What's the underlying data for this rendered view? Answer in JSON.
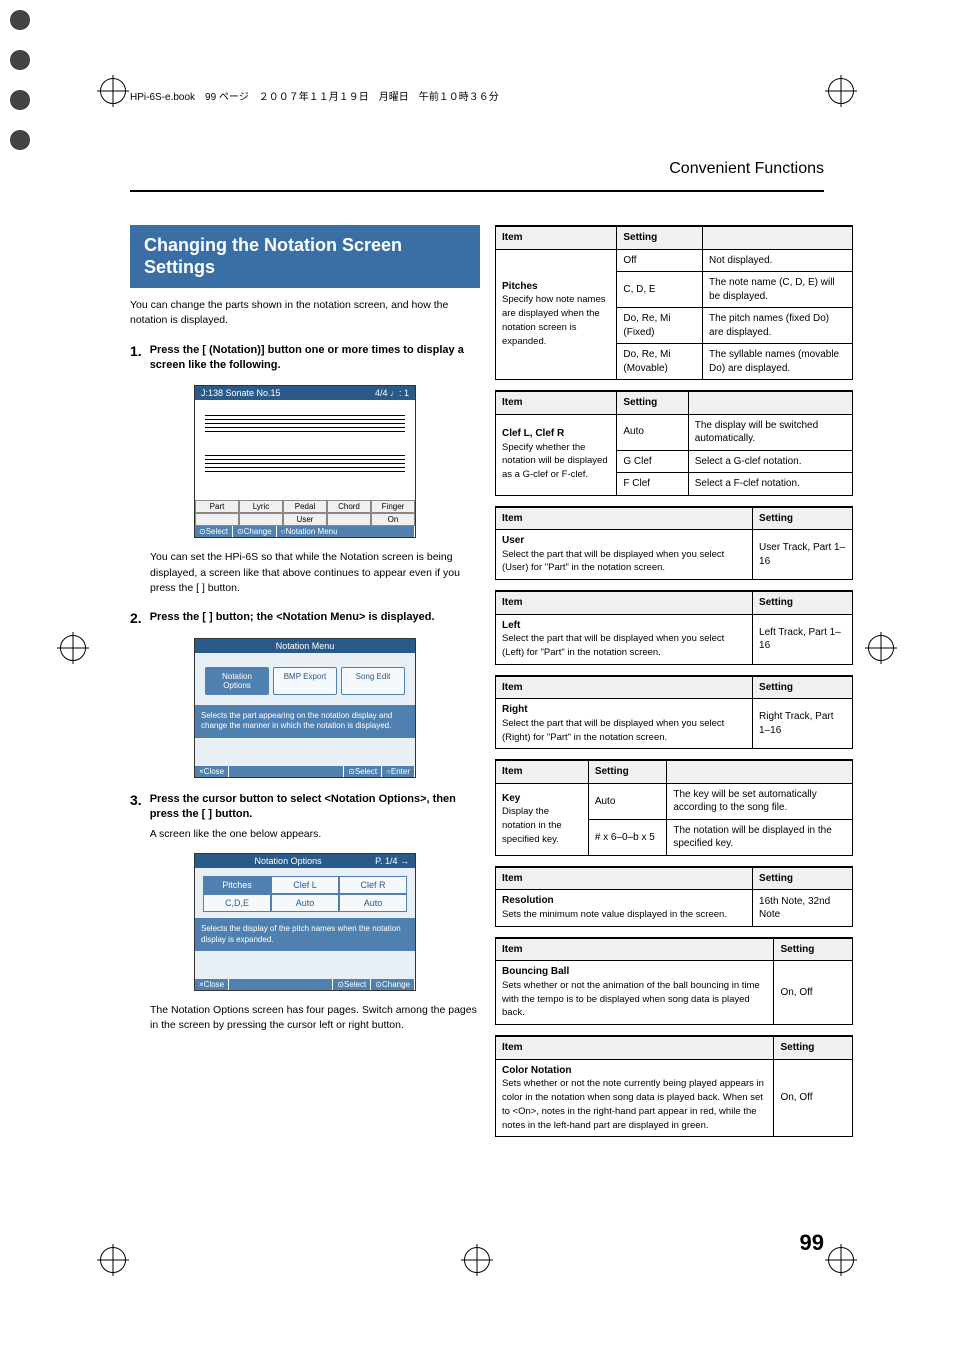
{
  "header_info": "HPi-6S-e.book　99 ページ　２００７年１１月１９日　月曜日　午前１０時３６分",
  "section_title": "Convenient Functions",
  "page_number": "99",
  "banner": "Changing the Notation Screen Settings",
  "intro": "You can change the parts shown in the notation screen, and how the notation is displayed.",
  "steps": [
    {
      "num": "1.",
      "text": "Press the [      (Notation)] button one or more times to display a screen like the following.",
      "note_after": "You can set the HPi-6S so that while the Notation screen is being displayed, a screen like that above continues to appear even if you press the [    ] button."
    },
    {
      "num": "2.",
      "text": "Press the [    ] button; the <Notation Menu> is displayed."
    },
    {
      "num": "3.",
      "text": "Press the       cursor button to select <Notation Options>, then press the [    ] button.",
      "sub": "A screen like the one below appears.",
      "tail": "The Notation Options screen has four pages. Switch among the pages in the screen by pressing the       cursor left or right button."
    }
  ],
  "shot1": {
    "title_left": "J:138 Sonate No.15",
    "title_right": "4/4 ♩:  1",
    "tabs": [
      "Part",
      "Lyric",
      "Pedal",
      "Chord",
      "Finger"
    ],
    "tabs2": [
      "",
      "",
      "User",
      "",
      "On"
    ],
    "status": [
      "⊙Select",
      "⊙Change",
      "○Notation Menu"
    ]
  },
  "shot2": {
    "title": "Notation Menu",
    "icons": [
      "Notation Options",
      "BMP Export",
      "Song Edit"
    ],
    "desc": "Selects the part appearing on the notation display and change the manner in which the notation is displayed.",
    "status": [
      "×Close",
      "⊙Select",
      "○Enter"
    ]
  },
  "shot3": {
    "title": "Notation Options",
    "page": "P. 1/4 →",
    "row1": [
      "Pitches",
      "Clef L",
      "Clef R"
    ],
    "row2": [
      "C,D,E",
      "Auto",
      "Auto"
    ],
    "desc": "Selects the display of the pitch names when the notation display is expanded.",
    "status": [
      "×Close",
      "⊙Select",
      "⊙Change"
    ]
  },
  "t1": {
    "head": [
      "Item",
      "Setting",
      ""
    ],
    "item": "Pitches",
    "desc": "Specify how note names are displayed when the notation screen is expanded.",
    "rows": [
      [
        "Off",
        "Not displayed."
      ],
      [
        "C, D, E",
        "The note name (C, D, E) will be displayed."
      ],
      [
        "Do, Re, Mi (Fixed)",
        "The pitch names (fixed Do) are displayed."
      ],
      [
        "Do, Re, Mi (Movable)",
        "The syllable names (movable Do) are displayed."
      ]
    ]
  },
  "t2": {
    "head": [
      "Item",
      "Setting",
      ""
    ],
    "item": "Clef L, Clef R",
    "desc": "Specify whether the notation will be displayed as a G-clef or F-clef.",
    "rows": [
      [
        "Auto",
        "The display will be switched automatically."
      ],
      [
        "G Clef",
        "Select a G-clef notation."
      ],
      [
        "F Clef",
        "Select a F-clef notation."
      ]
    ]
  },
  "t3": {
    "head": [
      "Item",
      "Setting"
    ],
    "item": "User",
    "desc": "Select the part that will be displayed when you select       (User) for \"Part\" in the notation screen.",
    "setting": "User Track, Part 1–16"
  },
  "t4": {
    "head": [
      "Item",
      "Setting"
    ],
    "item": "Left",
    "desc": "Select the part that will be displayed when you select      (Left) for \"Part\" in the notation screen.",
    "setting": "Left Track, Part 1–16"
  },
  "t5": {
    "head": [
      "Item",
      "Setting"
    ],
    "item": "Right",
    "desc": "Select the part that will be displayed when you select      (Right) for \"Part\" in the notation screen.",
    "setting": "Right Track, Part 1–16"
  },
  "t6": {
    "head": [
      "Item",
      "Setting",
      ""
    ],
    "item": "Key",
    "desc": "Display the notation in the specified key.",
    "rows": [
      [
        "Auto",
        "The key will be set automatically according to the song file."
      ],
      [
        "# x 6–0–b x 5",
        "The notation will be displayed in the specified key."
      ]
    ]
  },
  "t7": {
    "head": [
      "Item",
      "Setting"
    ],
    "item": "Resolution",
    "desc": "Sets the minimum note value displayed in the screen.",
    "setting": "16th Note, 32nd Note"
  },
  "t8": {
    "head": [
      "Item",
      "Setting"
    ],
    "item": "Bouncing Ball",
    "desc": "Sets whether or not the animation of the ball bouncing in time with the tempo is to be displayed when song data is played back.",
    "setting": "On, Off"
  },
  "t9": {
    "head": [
      "Item",
      "Setting"
    ],
    "item": "Color Notation",
    "desc": "Sets whether or not the note currently being played appears in color in the notation when song data is played back. When set to <On>, notes in the right-hand part appear in red, while the notes in the left-hand part are displayed in green.",
    "setting": "On, Off"
  }
}
